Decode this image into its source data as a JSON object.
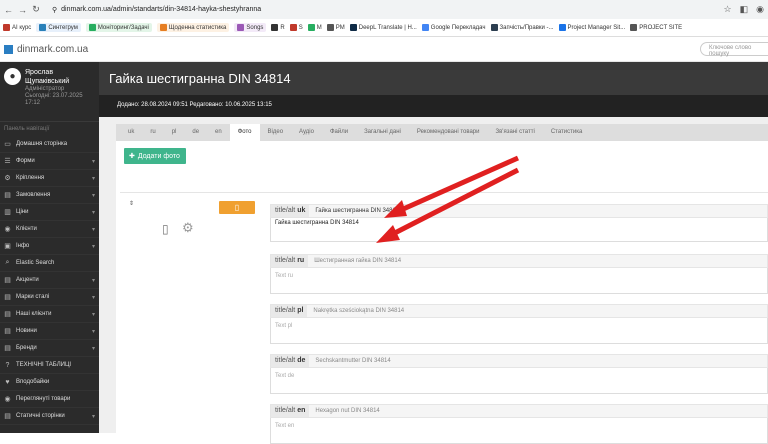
{
  "browser": {
    "url": "dinmark.com.ua/admin/standarts/din-34814-hayka-shestyhranna",
    "bookmarks": [
      {
        "label": "AI курс",
        "color": "#c0392b",
        "chip": false
      },
      {
        "label": "Синтегрум",
        "color": "#2980b9",
        "chip": true,
        "bg": "#e7f0fb"
      },
      {
        "label": "Моніторинг/Задачі",
        "color": "#27ae60",
        "chip": true,
        "bg": "#e3f5e8"
      },
      {
        "label": "Щоденна статистика",
        "color": "#e67e22",
        "chip": true,
        "bg": "#fdf1e3"
      },
      {
        "label": "Songs",
        "color": "#9b59b6",
        "chip": true,
        "bg": "#f3eaf8"
      },
      {
        "label": "R",
        "color": "#333",
        "chip": false
      },
      {
        "label": "S",
        "color": "#c0392b",
        "chip": false
      },
      {
        "label": "M",
        "color": "#27ae60",
        "chip": false
      },
      {
        "label": "PM",
        "color": "#555",
        "chip": false
      },
      {
        "label": "DeepL Translate | Н...",
        "color": "#0f2b46",
        "chip": false
      },
      {
        "label": "Google Перекладач",
        "color": "#4285f4",
        "chip": false
      },
      {
        "label": "Запчість/Правки -...",
        "color": "#2c3e50",
        "chip": false
      },
      {
        "label": "Project Manager Sit...",
        "color": "#1a73e8",
        "chip": false
      },
      {
        "label": "PROJECT SITE",
        "color": "#555",
        "chip": false
      }
    ]
  },
  "site": {
    "logo": "dinmark.com.ua",
    "search_placeholder": "Ключове слово пошуку"
  },
  "user": {
    "name_line1": "Ярослав",
    "name_line2": "Щупаківський",
    "role": "Адміністратор",
    "today": "Сьогодні: 23.07.2025 17:12"
  },
  "nav": {
    "header": "Панель навігації",
    "items": [
      {
        "label": "Домашня сторінка",
        "icon": "▭",
        "caret": false
      },
      {
        "label": "Форми",
        "icon": "☰",
        "caret": true
      },
      {
        "label": "Кріплення",
        "icon": "⚙",
        "caret": true
      },
      {
        "label": "Замовлення",
        "icon": "▤",
        "caret": true
      },
      {
        "label": "Ціни",
        "icon": "▥",
        "caret": true
      },
      {
        "label": "Клієнти",
        "icon": "◉",
        "caret": true
      },
      {
        "label": "Інфо",
        "icon": "▣",
        "caret": true
      },
      {
        "label": "Elastic Search",
        "icon": "⌕",
        "caret": false
      },
      {
        "label": "Акценти",
        "icon": "▤",
        "caret": true
      },
      {
        "label": "Марки сталі",
        "icon": "▤",
        "caret": true
      },
      {
        "label": "Наші клієнти",
        "icon": "▤",
        "caret": true
      },
      {
        "label": "Новини",
        "icon": "▤",
        "caret": true
      },
      {
        "label": "Бренди",
        "icon": "▤",
        "caret": true
      },
      {
        "label": "ТЕХНІЧНІ ТАБЛИЦІ",
        "icon": "?",
        "caret": false
      },
      {
        "label": "Вподобайки",
        "icon": "♥",
        "caret": false
      },
      {
        "label": "Переглянуті товари",
        "icon": "◉",
        "caret": false
      },
      {
        "label": "Статичні сторінки",
        "icon": "▤",
        "caret": true
      }
    ]
  },
  "page": {
    "title": "Гайка шестигранна DIN 34814",
    "info": "Додано: 28.08.2024 09:51 Редаговано: 10.06.2025 13:15",
    "tabs": [
      "uk",
      "ru",
      "pl",
      "de",
      "en",
      "Фото",
      "Відео",
      "Аудіо",
      "Файли",
      "Загальні дані",
      "Рекомендовані товари",
      "Зв'язані статті",
      "Статистика"
    ],
    "active_tab": 5,
    "add_photo": "Додати фото",
    "pin": "⇕",
    "locales": [
      {
        "label": "title/alt",
        "code": "uk",
        "value": "Гайка шестигранна DIN 34814",
        "text": "Гайка шестигранна DIN 34814",
        "filled": true
      },
      {
        "label": "title/alt",
        "code": "ru",
        "value": "Шестигранная гайка DIN 34814",
        "text": "Text ru",
        "filled": false
      },
      {
        "label": "title/alt",
        "code": "pl",
        "value": "Nakrętka sześciokątna DIN 34814",
        "text": "Text pl",
        "filled": false
      },
      {
        "label": "title/alt",
        "code": "de",
        "value": "Sechskantmutter DIN 34814",
        "text": "Text de",
        "filled": false
      },
      {
        "label": "title/alt",
        "code": "en",
        "value": "Hexagon nut DIN 34814",
        "text": "Text en",
        "filled": false
      }
    ]
  },
  "colors": {
    "arrow": "#e02020",
    "add_button": "#3fb58c",
    "phone_button": "#f0a030"
  }
}
